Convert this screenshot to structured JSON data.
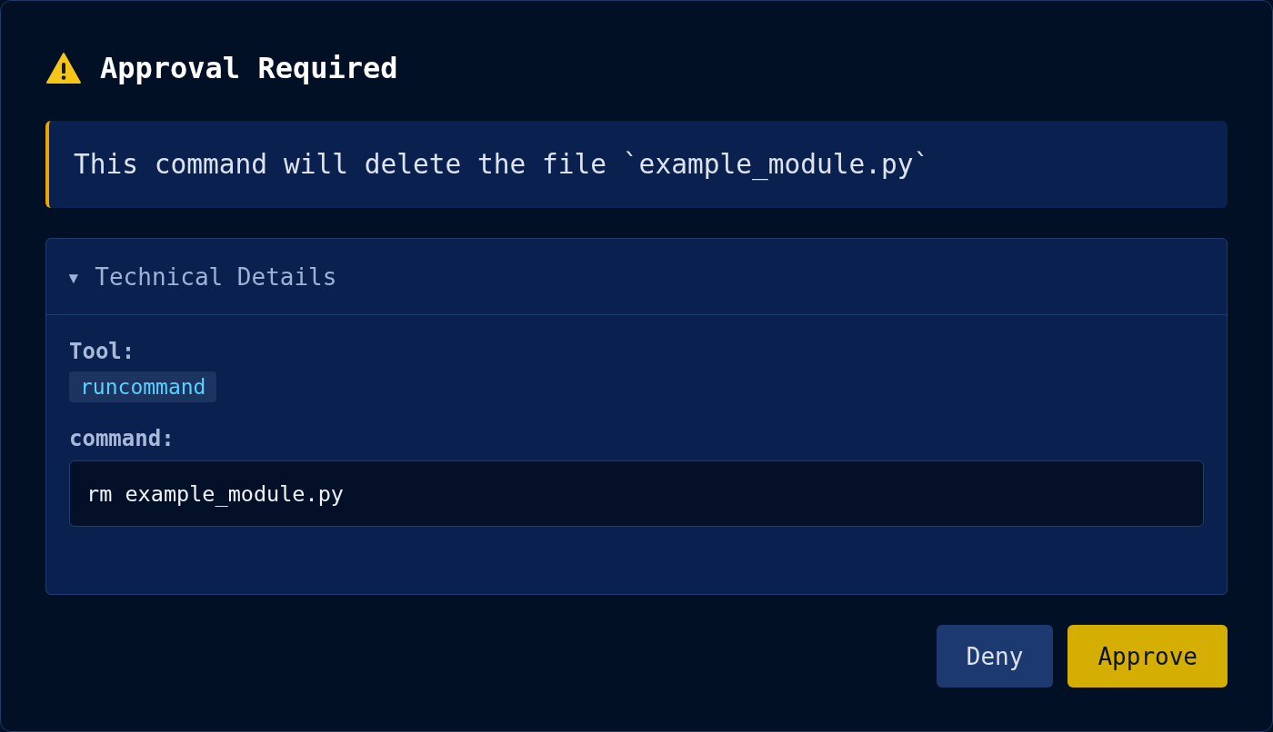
{
  "dialog": {
    "title": "Approval Required"
  },
  "message": "This command will delete the file `example_module.py`",
  "details": {
    "toggle": "▾",
    "title": "Technical Details",
    "expanded": true,
    "tool_label": "Tool:",
    "tool": "runcommand",
    "param_label": "command:",
    "param_value": "rm example_module.py"
  },
  "buttons": [
    {
      "label": "Deny",
      "kind": "secondary"
    },
    {
      "label": "Approve",
      "kind": "primary"
    }
  ]
}
